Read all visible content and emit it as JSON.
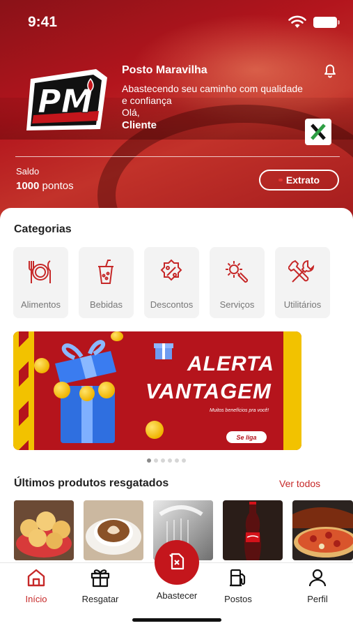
{
  "status_bar": {
    "time": "9:41"
  },
  "header": {
    "logo_text": "PM",
    "station_name": "Posto Maravilha",
    "tagline": "Abastecendo seu caminho com qualidade e confiança",
    "greeting": "Olá,",
    "client_name": "Cliente",
    "balance_label": "Saldo",
    "balance_value": "1000",
    "balance_unit": "pontos",
    "extrato_label": "Extrato"
  },
  "categories": {
    "title": "Categorias",
    "items": [
      {
        "label": "Alimentos",
        "icon": "cutlery-icon"
      },
      {
        "label": "Bebidas",
        "icon": "drink-cup-icon"
      },
      {
        "label": "Descontos",
        "icon": "discount-badge-icon"
      },
      {
        "label": "Serviços",
        "icon": "gear-wrench-icon"
      },
      {
        "label": "Utilitários",
        "icon": "tools-icon"
      }
    ]
  },
  "banner": {
    "line1": "ALERTA",
    "line2": "VANTAGEM",
    "subtitle": "Muitos benefícios pra você!",
    "cta": "Se liga",
    "page_count": 6,
    "active_page": 0
  },
  "recent": {
    "title": "Últimos produtos resgatados",
    "see_all": "Ver todos",
    "items": [
      {
        "name": "pao-de-queijo"
      },
      {
        "name": "cafe"
      },
      {
        "name": "lavagem"
      },
      {
        "name": "coca-cola"
      },
      {
        "name": "pizza"
      }
    ]
  },
  "tabbar": {
    "home": "Início",
    "redeem": "Resgatar",
    "fuel": "Abastecer",
    "stations": "Postos",
    "profile": "Perfil"
  },
  "colors": {
    "brand_red": "#c4161c",
    "accent_yellow": "#f2c200",
    "active_tab": "#c62828"
  }
}
